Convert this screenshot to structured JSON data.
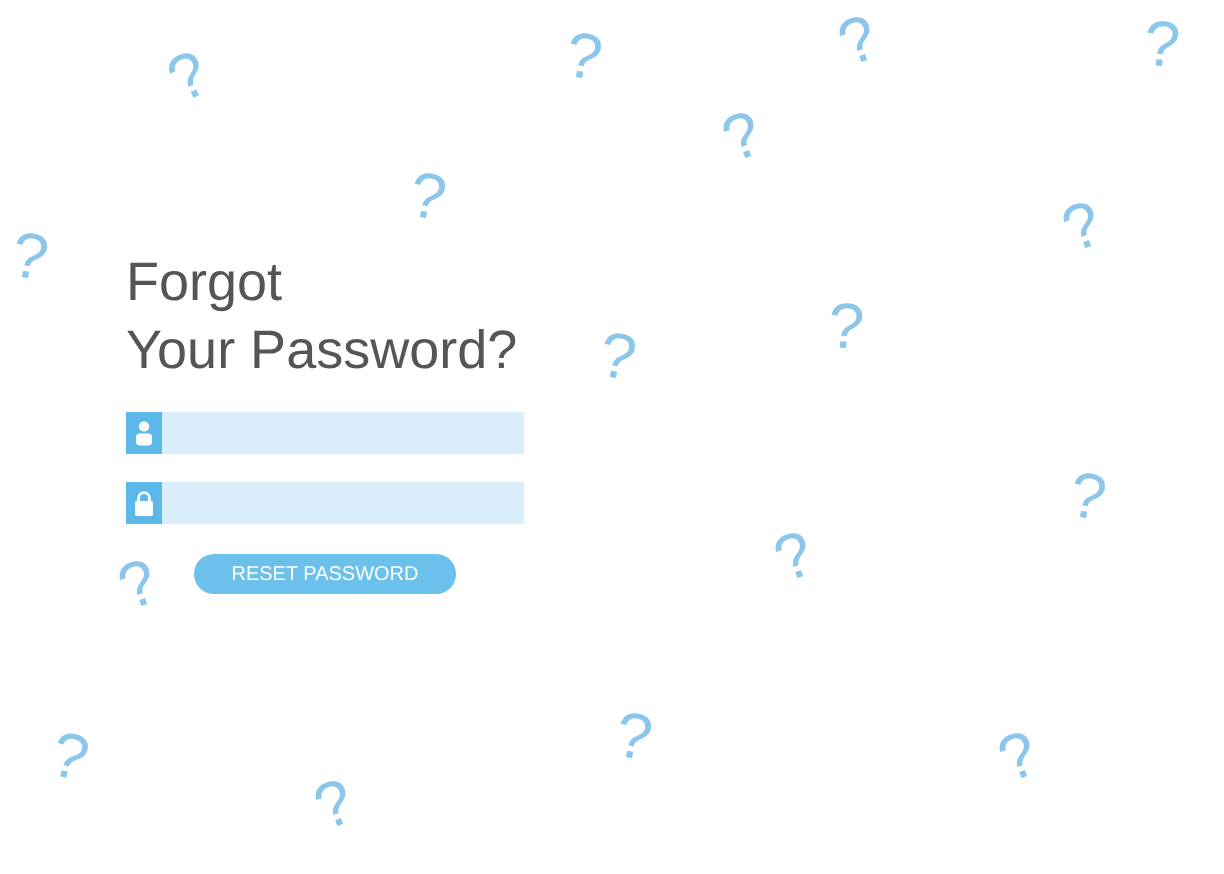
{
  "title_lines": [
    "Forgot",
    "Your Password?"
  ],
  "fields": [
    {
      "kind": "user"
    },
    {
      "kind": "lock"
    }
  ],
  "button": {
    "label": "RESET PASSWORD"
  },
  "decorations": [
    {
      "glyph": "?"
    },
    {
      "glyph": "?"
    },
    {
      "glyph": "?"
    },
    {
      "glyph": "?"
    },
    {
      "glyph": "?"
    },
    {
      "glyph": "?"
    },
    {
      "glyph": "?"
    },
    {
      "glyph": "?"
    },
    {
      "glyph": "?"
    },
    {
      "glyph": "?"
    },
    {
      "glyph": "?"
    },
    {
      "glyph": "?"
    },
    {
      "glyph": "?"
    },
    {
      "glyph": "?"
    },
    {
      "glyph": "?"
    },
    {
      "glyph": "?"
    },
    {
      "glyph": "?"
    }
  ]
}
